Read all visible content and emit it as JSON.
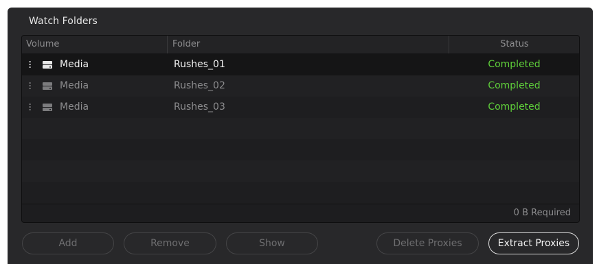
{
  "panel": {
    "title": "Watch Folders"
  },
  "table": {
    "headers": {
      "volume": "Volume",
      "folder": "Folder",
      "status": "Status"
    },
    "rows": [
      {
        "volume": "Media",
        "folder": "Rushes_01",
        "status": "Completed",
        "selected": true
      },
      {
        "volume": "Media",
        "folder": "Rushes_02",
        "status": "Completed",
        "selected": false
      },
      {
        "volume": "Media",
        "folder": "Rushes_03",
        "status": "Completed",
        "selected": false
      }
    ],
    "footer": "0 B Required"
  },
  "buttons": {
    "add": "Add",
    "remove": "Remove",
    "show": "Show",
    "delete_proxies": "Delete Proxies",
    "extract_proxies": "Extract Proxies"
  },
  "colors": {
    "status_completed": "#5fcf3a",
    "panel_bg": "#28282a",
    "table_bg": "#1e1e20"
  },
  "icons": {
    "row_handle": "drag-handle-icon",
    "volume": "drive-icon"
  }
}
